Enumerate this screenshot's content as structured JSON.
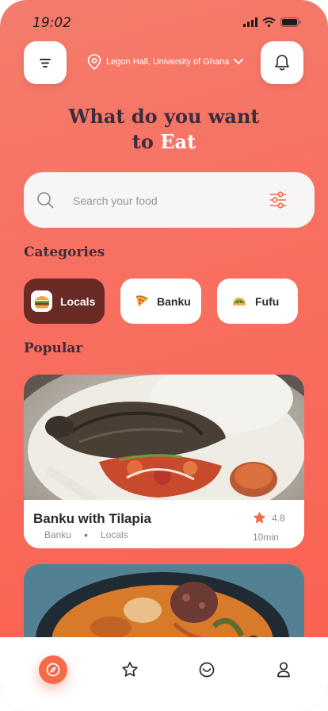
{
  "status": {
    "time": "19:02"
  },
  "header": {
    "location": "Legon Hall, University of Ghana"
  },
  "headline": {
    "line1": "What do you want",
    "line2_prefix": "to ",
    "line2_accent": "Eat"
  },
  "search": {
    "placeholder": "Search your food"
  },
  "categories": {
    "title": "Categories",
    "items": [
      {
        "label": "Locals",
        "icon": "burger-icon"
      },
      {
        "label": "Banku",
        "icon": "pizza-icon"
      },
      {
        "label": "Fufu",
        "icon": "taco-icon"
      }
    ]
  },
  "popular": {
    "title": "Popular",
    "items": [
      {
        "name": "Banku with Tilapia",
        "category": "Banku",
        "group": "Locals",
        "rating": "4.8",
        "time": "10min"
      }
    ]
  },
  "nav": {
    "items": [
      "home-icon",
      "star-icon",
      "orders-icon",
      "profile-icon"
    ]
  },
  "colors": {
    "accent": "#f56a48",
    "dark": "#3b2d3d",
    "chip_active": "#6a2a26"
  }
}
